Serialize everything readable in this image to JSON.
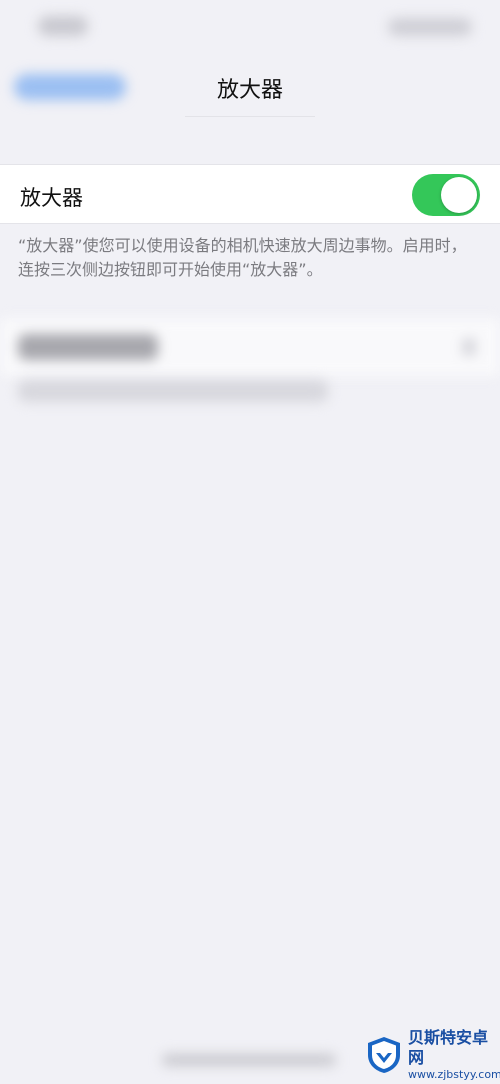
{
  "nav": {
    "title": "放大器"
  },
  "setting": {
    "label": "放大器",
    "toggle_on": true,
    "toggle_color": "#34c759"
  },
  "footer": {
    "text": "“放大器”使您可以使用设备的相机快速放大周边事物。启用时，连按三次侧边按钮即可开始使用“放大器”。"
  },
  "watermark": {
    "brand": "贝斯特安卓网",
    "url": "www.zjbstyy.com"
  }
}
